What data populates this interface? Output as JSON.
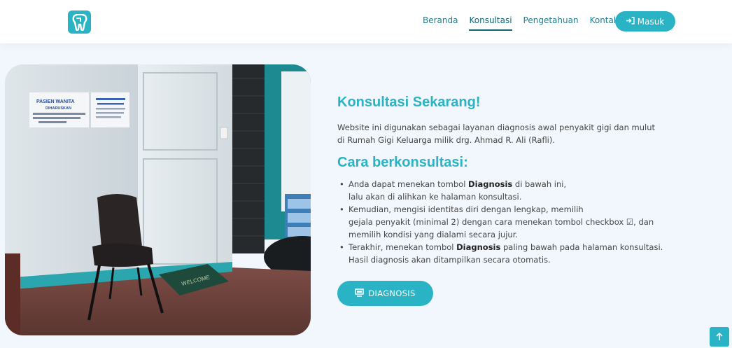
{
  "nav": {
    "links": [
      "Beranda",
      "Konsultasi",
      "Pengetahuan",
      "Kontak"
    ],
    "active": "Konsultasi",
    "login_label": "Masuk"
  },
  "photo": {
    "poster1_title": "PASIEN WANITA",
    "poster1_sub": "DIHARUSKAN",
    "poster1_text": "BERSAMA KERABAT (ISTRI / SAUDARA / SUAMI / ANAK, DLL)",
    "poster2_title": "MOHON MENJAGA KEBERSIHAN",
    "mat_text": "WELCOME"
  },
  "hero": {
    "title": "Konsultasi Sekarang!",
    "description_lines": [
      "Website ini digunakan sebagai layanan diagnosis awal penyakit gigi dan mulut",
      "di Rumah Gigi Keluarga milik drg. Ahmad R. Ali (Rafli)."
    ],
    "subtitle": "Cara berkonsultasi:",
    "steps": [
      {
        "line1_pre": "Anda dapat menekan tombol ",
        "line1_bold": "Diagnosis",
        "line1_post": " di bawah ini,",
        "line2": "lalu akan di alihkan ke halaman konsultasi."
      },
      {
        "line1": "Kemudian, mengisi identitas diri dengan lengkap, memilih",
        "line2": "gejala penyakit (minimal 2) dengan cara menekan tombol checkbox ☑, dan",
        "line3": "memilih kondisi yang dialami secara jujur."
      },
      {
        "line1_pre": "Terakhir, menekan tombol ",
        "line1_bold": "Diagnosis",
        "line1_post": " paling bawah pada halaman konsultasi.",
        "line2": "Hasil diagnosis akan ditampilkan secara otomatis."
      }
    ],
    "button_label": "DIAGNOSIS"
  },
  "colors": {
    "accent": "#2ab3c4",
    "nav_link": "#1f7f8e",
    "background": "#f1f7fd"
  },
  "icons": [
    "tooth-logo-icon",
    "login-icon",
    "monitor-icon",
    "arrow-up-icon"
  ]
}
